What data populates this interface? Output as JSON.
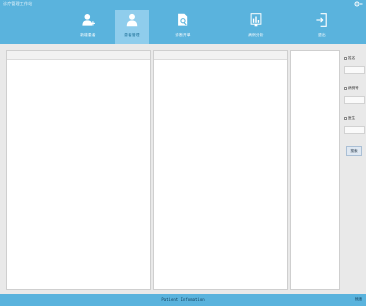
{
  "window": {
    "title": "诊疗管理工作站"
  },
  "toolbar": {
    "items": [
      {
        "label": "新增患者",
        "icon": "add-person-icon",
        "active": false
      },
      {
        "label": "患者管理",
        "icon": "person-icon",
        "active": true
      },
      {
        "label": "诊断开单",
        "icon": "document-search-icon",
        "active": false
      },
      {
        "label": "病例分析",
        "icon": "chart-icon",
        "active": false
      },
      {
        "label": "退出",
        "icon": "exit-icon",
        "active": false
      }
    ]
  },
  "filters": {
    "fields": [
      {
        "label": "姓名",
        "value": ""
      },
      {
        "label": "病例号",
        "value": ""
      },
      {
        "label": "医生",
        "value": ""
      }
    ],
    "search_label": "搜索"
  },
  "statusbar": {
    "text": "Patient Infomation",
    "right": "就绪"
  },
  "colors": {
    "toolbar": "#5ab3dd",
    "active_tool": "#8fcdec",
    "background": "#e9e9e9"
  }
}
